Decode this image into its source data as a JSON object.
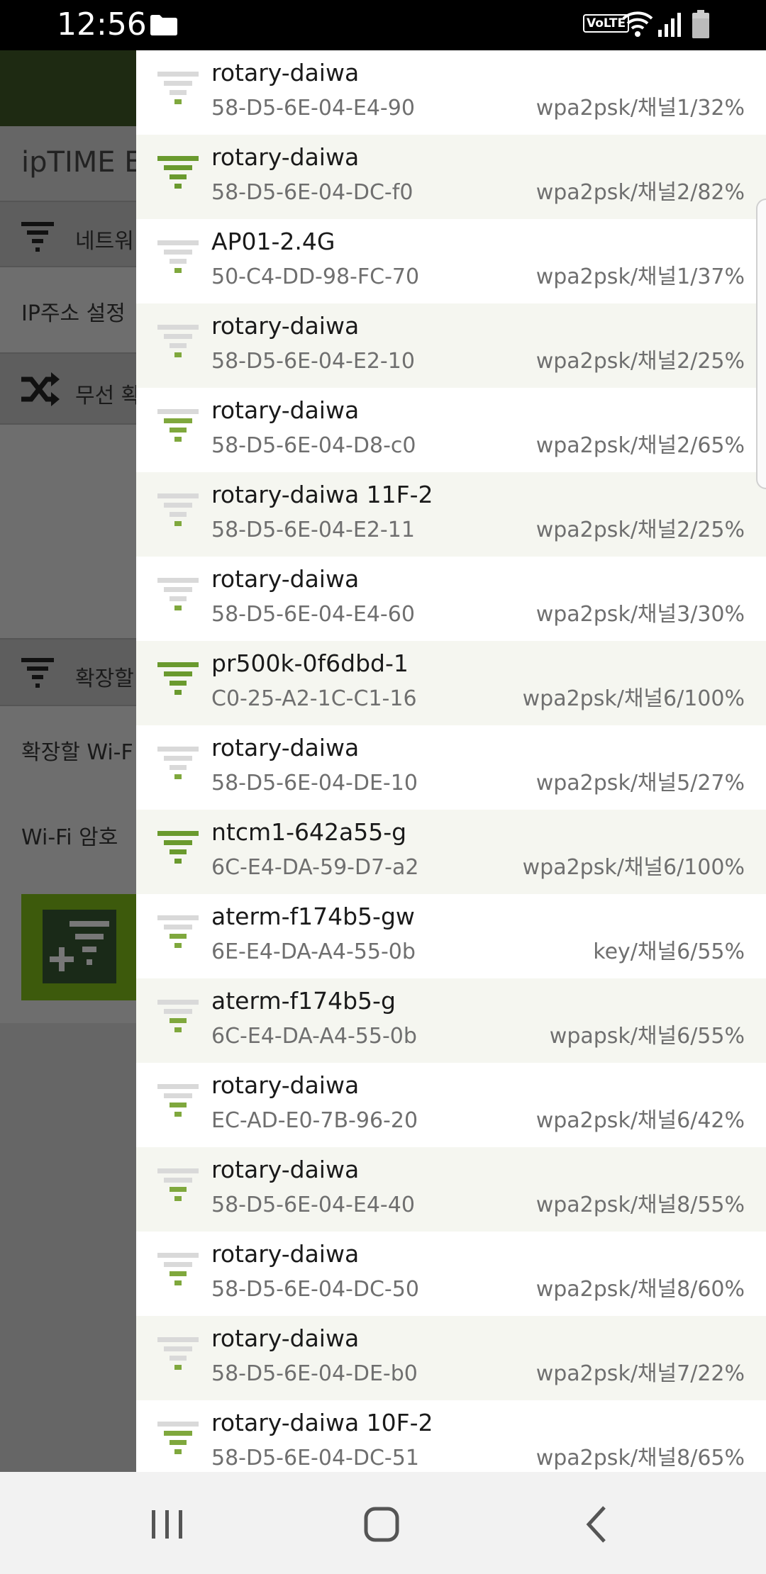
{
  "status_bar": {
    "time": "12:56",
    "volte_label": "VoLTE",
    "icons": [
      "folder-icon",
      "volte-icon",
      "wifi-icon",
      "signal-icon",
      "battery-icon"
    ]
  },
  "background_app": {
    "title": "ipTIME E",
    "section_network": "네트워",
    "ip_row": "IP주소 설정",
    "section_wireless": "무선 확",
    "section_extend": "확장할",
    "extend_wifi_row": "확장할 Wi-F",
    "wifi_password_row": "Wi-Fi 암호"
  },
  "colors": {
    "strong_signal": "#6a9a2e",
    "weak_signal": "#7fa83d",
    "inactive_bar": "#d9d9d9"
  },
  "networks": [
    {
      "ssid": "rotary-daiwa",
      "mac": "58-D5-6E-04-E4-90",
      "info": "wpa2psk/채널1/32%",
      "strength": 1
    },
    {
      "ssid": "rotary-daiwa",
      "mac": "58-D5-6E-04-DC-f0",
      "info": "wpa2psk/채널2/82%",
      "strength": 4
    },
    {
      "ssid": "AP01-2.4G",
      "mac": "50-C4-DD-98-FC-70",
      "info": "wpa2psk/채널1/37%",
      "strength": 1
    },
    {
      "ssid": "rotary-daiwa",
      "mac": "58-D5-6E-04-E2-10",
      "info": "wpa2psk/채널2/25%",
      "strength": 1
    },
    {
      "ssid": "rotary-daiwa",
      "mac": "58-D5-6E-04-D8-c0",
      "info": "wpa2psk/채널2/65%",
      "strength": 3
    },
    {
      "ssid": "rotary-daiwa 11F-2",
      "mac": "58-D5-6E-04-E2-11",
      "info": "wpa2psk/채널2/25%",
      "strength": 1
    },
    {
      "ssid": "rotary-daiwa",
      "mac": "58-D5-6E-04-E4-60",
      "info": "wpa2psk/채널3/30%",
      "strength": 1
    },
    {
      "ssid": "pr500k-0f6dbd-1",
      "mac": "C0-25-A2-1C-C1-16",
      "info": "wpa2psk/채널6/100%",
      "strength": 4
    },
    {
      "ssid": "rotary-daiwa",
      "mac": "58-D5-6E-04-DE-10",
      "info": "wpa2psk/채널5/27%",
      "strength": 1
    },
    {
      "ssid": "ntcm1-642a55-g",
      "mac": "6C-E4-DA-59-D7-a2",
      "info": "wpa2psk/채널6/100%",
      "strength": 4
    },
    {
      "ssid": "aterm-f174b5-gw",
      "mac": "6E-E4-DA-A4-55-0b",
      "info": "key/채널6/55%",
      "strength": 2
    },
    {
      "ssid": "aterm-f174b5-g",
      "mac": "6C-E4-DA-A4-55-0b",
      "info": "wpapsk/채널6/55%",
      "strength": 2
    },
    {
      "ssid": "rotary-daiwa",
      "mac": "EC-AD-E0-7B-96-20",
      "info": "wpa2psk/채널6/42%",
      "strength": 2
    },
    {
      "ssid": "rotary-daiwa",
      "mac": "58-D5-6E-04-E4-40",
      "info": "wpa2psk/채널8/55%",
      "strength": 2
    },
    {
      "ssid": "rotary-daiwa",
      "mac": "58-D5-6E-04-DC-50",
      "info": "wpa2psk/채널8/60%",
      "strength": 2
    },
    {
      "ssid": "rotary-daiwa",
      "mac": "58-D5-6E-04-DE-b0",
      "info": "wpa2psk/채널7/22%",
      "strength": 1
    },
    {
      "ssid": "rotary-daiwa 10F-2",
      "mac": "58-D5-6E-04-DC-51",
      "info": "wpa2psk/채널8/65%",
      "strength": 3
    }
  ],
  "nav_bar": {
    "icons": [
      "recent-apps-icon",
      "home-icon",
      "back-icon"
    ]
  }
}
